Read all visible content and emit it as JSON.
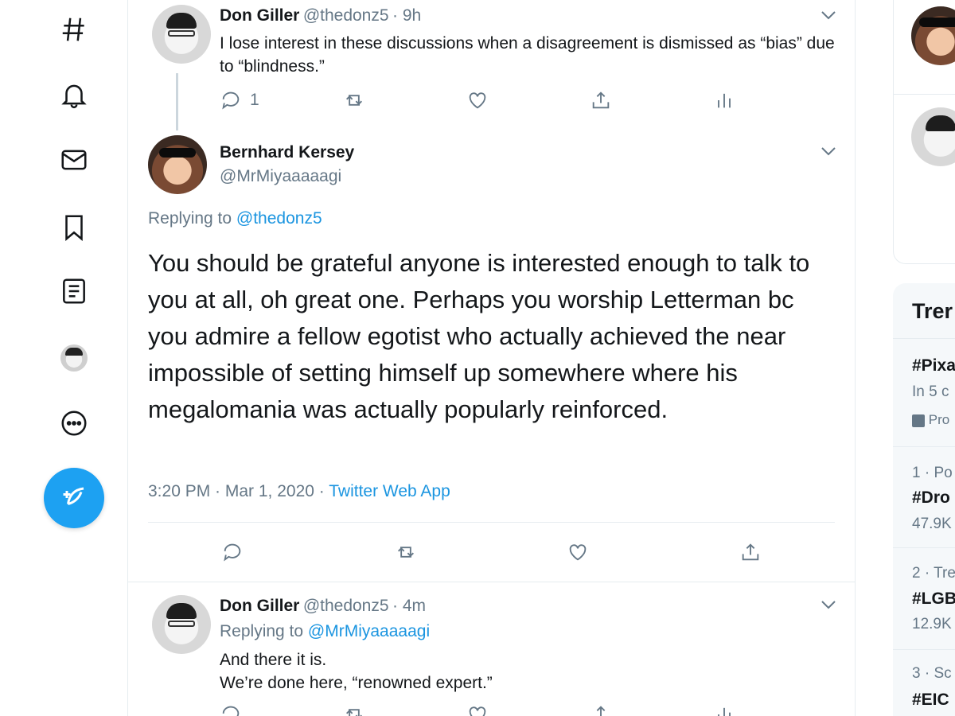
{
  "nav": {
    "items": [
      {
        "icon": "hashtag-icon"
      },
      {
        "icon": "bell-icon"
      },
      {
        "icon": "mail-icon"
      },
      {
        "icon": "bookmark-icon"
      },
      {
        "icon": "list-icon"
      },
      {
        "icon": "profile-avatar-icon"
      },
      {
        "icon": "more-icon"
      }
    ],
    "compose_icon": "compose-feather-icon"
  },
  "tweets": {
    "first": {
      "name": "Don Giller",
      "handle": "@thedonz5",
      "time": "· 9h",
      "text": "I lose interest in these discussions when a disagreement is dismissed as “bias” due to “blindness.”",
      "reply_count": "1"
    },
    "main": {
      "name": "Bernhard Kersey",
      "handle": "@MrMiyaaaaagi",
      "replying_label": "Replying to",
      "replying_to": "@thedonz5",
      "text": "You should be grateful anyone is interested enough to talk to you at all, oh great one. Perhaps you worship Letterman bc you admire a fellow egotist who actually achieved the near impossible of setting himself up somewhere where his megalomania was actually popularly reinforced.",
      "timestamp": "3:20 PM · Mar 1, 2020 ·",
      "source": "Twitter Web App"
    },
    "reply": {
      "name": "Don Giller",
      "handle": "@thedonz5",
      "time": "· 4m",
      "replying_label": "Replying to",
      "replying_to": "@MrMiyaaaaagi",
      "line1": "And there it is.",
      "line2": "We’re done here, “renowned expert.”"
    }
  },
  "sidebar": {
    "trends_title": "Trer",
    "trends": [
      {
        "tag": "#Pixa",
        "meta": "In 5 c",
        "promoted": "Pro"
      },
      {
        "meta": "1 · Po",
        "tag": "#Dro",
        "count": "47.9K"
      },
      {
        "meta": "2 · Tre",
        "tag": "#LGB",
        "count": "12.9K"
      },
      {
        "meta": "3 · Sc",
        "tag": "#EIC"
      }
    ]
  },
  "colors": {
    "accent": "#1da1f2",
    "link": "#1b95e0",
    "muted": "#657786",
    "border": "#e6ecf0"
  }
}
